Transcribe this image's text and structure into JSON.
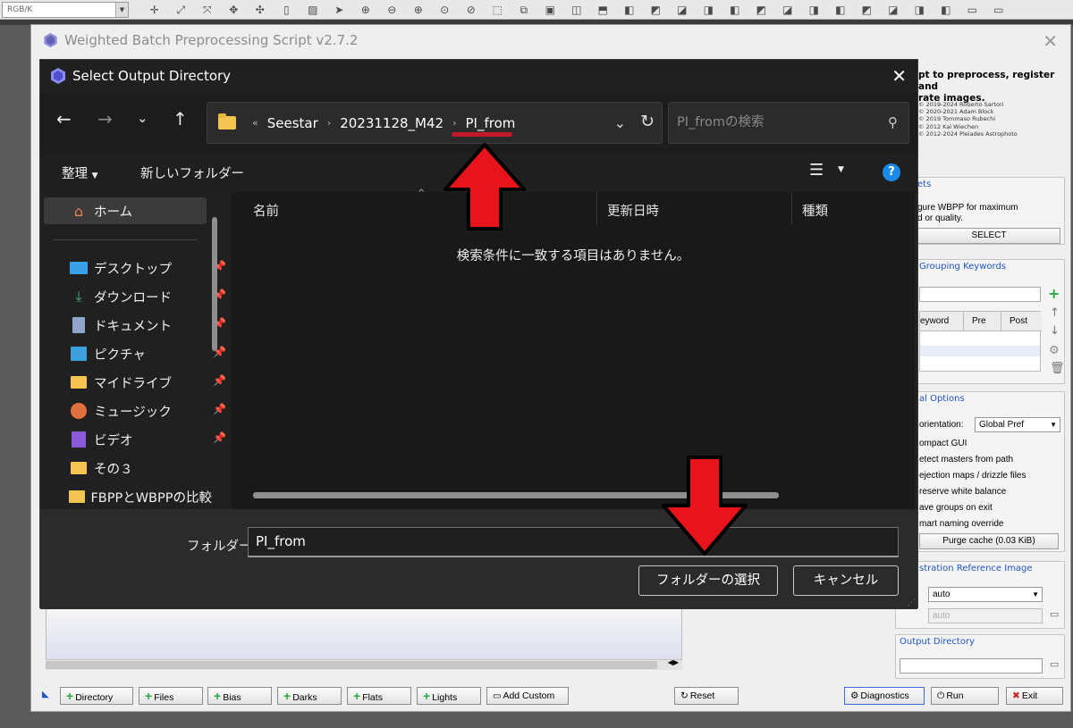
{
  "toolbar": {
    "color_mode": "RGB/K"
  },
  "wbpp": {
    "title": "Weighted Batch Preprocessing Script v2.7.2",
    "description_lines": [
      "pt to preprocess, register and",
      "rate images."
    ],
    "credits": [
      "© 2019-2024 Roberto Sartori",
      "© 2020-2021 Adam Block",
      "© 2019 Tommaso Rubechi",
      "© 2012 Kai Wiechen",
      "© 2012-2024 Pleiades Astrophoto"
    ],
    "presets": {
      "title": "ets",
      "text_lines": [
        "gure WBPP for maximum",
        "d or quality."
      ],
      "select_label": "SELECT"
    },
    "grouping": {
      "title": "Grouping Keywords",
      "col_keyword": "eyword",
      "col_pre": "Pre",
      "col_post": "Post"
    },
    "global_options": {
      "title": "al Options",
      "orientation_label": "orientation:",
      "orientation_value": "Global Pref",
      "options": [
        "ompact GUI",
        "etect masters from path",
        "ejection maps / drizzle files",
        "reserve white balance",
        "ave groups on exit",
        "mart naming override"
      ],
      "purge_label": "Purge cache (0.03 KiB)"
    },
    "registration": {
      "title": "stration Reference Image",
      "mode_value": "auto",
      "field_value": "auto"
    },
    "output": {
      "title": "Output Directory"
    },
    "bottom": {
      "directory": "Directory",
      "files": "Files",
      "bias": "Bias",
      "darks": "Darks",
      "flats": "Flats",
      "lights": "Lights",
      "add_custom": "Add Custom",
      "reset": "Reset",
      "diagnostics": "Diagnostics",
      "run": "Run",
      "exit": "Exit"
    }
  },
  "dialog": {
    "title": "Select Output Directory",
    "address": {
      "overflow": "«",
      "crumbs": [
        "Seestar",
        "20231128_M42",
        "PI_from"
      ]
    },
    "search_placeholder": "PI_fromの検索",
    "commands": {
      "organize": "整理",
      "new_folder": "新しいフォルダー"
    },
    "sidebar": {
      "home": "ホーム",
      "items": [
        "デスクトップ",
        "ダウンロード",
        "ドキュメント",
        "ピクチャ",
        "マイドライブ",
        "ミュージック",
        "ビデオ",
        "その３",
        "FBPPとWBPPの比較"
      ]
    },
    "columns": {
      "name": "名前",
      "modified": "更新日時",
      "type": "種類"
    },
    "empty_message": "検索条件に一致する項目はありません。",
    "folder_label": "フォルダー:",
    "folder_value": "PI_from",
    "select_folder": "フォルダーの選択",
    "cancel": "キャンセル"
  },
  "colors": {
    "arrow": "#e8141b",
    "underline": "#c21a2a",
    "accent_blue": "#1f55c5",
    "help": "#1a8ae8"
  }
}
